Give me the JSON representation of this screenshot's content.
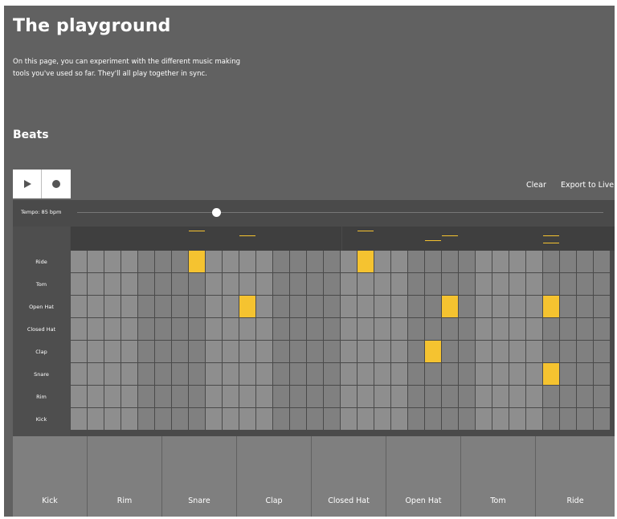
{
  "page": {
    "title": "The playground",
    "intro": "On this page, you can experiment with the different music making tools you've used so far. They'll all play together in sync.",
    "section_title": "Beats"
  },
  "toolbar": {
    "play_icon": "play-icon",
    "record_icon": "record-icon",
    "clear_label": "Clear",
    "export_label": "Export to Live"
  },
  "tempo": {
    "label": "Tempo: 85 bpm",
    "bpm": 85
  },
  "colors": {
    "accent": "#f5c330",
    "panel": "#616161",
    "cell": "#8e8e8e",
    "cell_shaded": "#808080",
    "pad": "#7f7f7f"
  },
  "sequencer": {
    "steps": 32,
    "tracks": [
      "Ride",
      "Tom",
      "Open Hat",
      "Closed Hat",
      "Clap",
      "Snare",
      "Rim",
      "Kick"
    ],
    "active": {
      "Ride": [
        7,
        17
      ],
      "Tom": [],
      "Open Hat": [
        10,
        22,
        28
      ],
      "Closed Hat": [],
      "Clap": [
        21
      ],
      "Snare": [
        28
      ],
      "Rim": [],
      "Kick": []
    }
  },
  "pads": [
    "Kick",
    "Rim",
    "Snare",
    "Clap",
    "Closed Hat",
    "Open Hat",
    "Tom",
    "Ride"
  ]
}
